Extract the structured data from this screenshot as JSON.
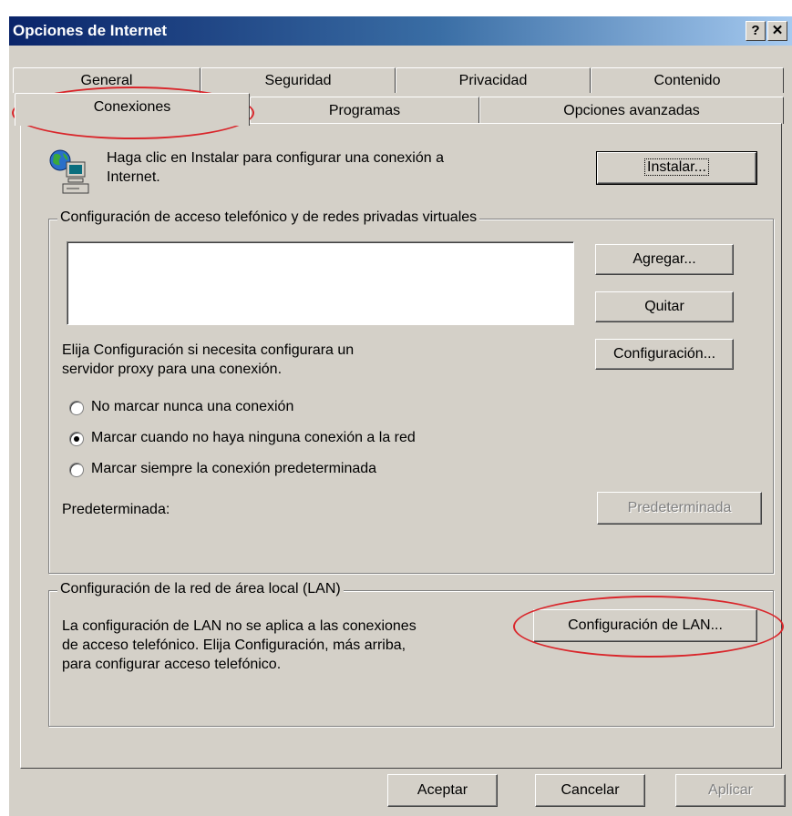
{
  "window": {
    "title": "Opciones de Internet",
    "help_button": "?",
    "close_button": "✕"
  },
  "tabs": {
    "row1": [
      "General",
      "Seguridad",
      "Privacidad",
      "Contenido"
    ],
    "row2": [
      "Conexiones",
      "Programas",
      "Opciones avanzadas"
    ],
    "selected": "Conexiones"
  },
  "install": {
    "text_line1": "Haga clic en Instalar para configurar una conexión a",
    "text_line2": "Internet.",
    "button": "Instalar..."
  },
  "dialup_group": {
    "legend": "Configuración de acceso telefónico y de redes privadas virtuales",
    "add_button": "Agregar...",
    "remove_button": "Quitar",
    "settings_button": "Configuración...",
    "proxy_text_line1": "Elija Configuración si necesita configurara un",
    "proxy_text_line2": "servidor proxy para una conexión.",
    "radio_options": [
      "No marcar nunca una conexión",
      "Marcar cuando no haya ninguna conexión a la red",
      "Marcar siempre la conexión predeterminada"
    ],
    "selected_option": "Marcar cuando no haya ninguna conexión a la red",
    "default_label": "Predeterminada:",
    "default_button": "Predeterminada"
  },
  "lan_group": {
    "legend": "Configuración de la red de área local (LAN)",
    "text_line1": "La configuración de LAN no se aplica a las conexiones",
    "text_line2": "de acceso telefónico. Elija Configuración, más arriba,",
    "text_line3": "para configurar acceso telefónico.",
    "lan_button": "Configuración de LAN..."
  },
  "footer": {
    "ok": "Aceptar",
    "cancel": "Cancelar",
    "apply": "Aplicar"
  },
  "annotation_color": "#d9262b"
}
